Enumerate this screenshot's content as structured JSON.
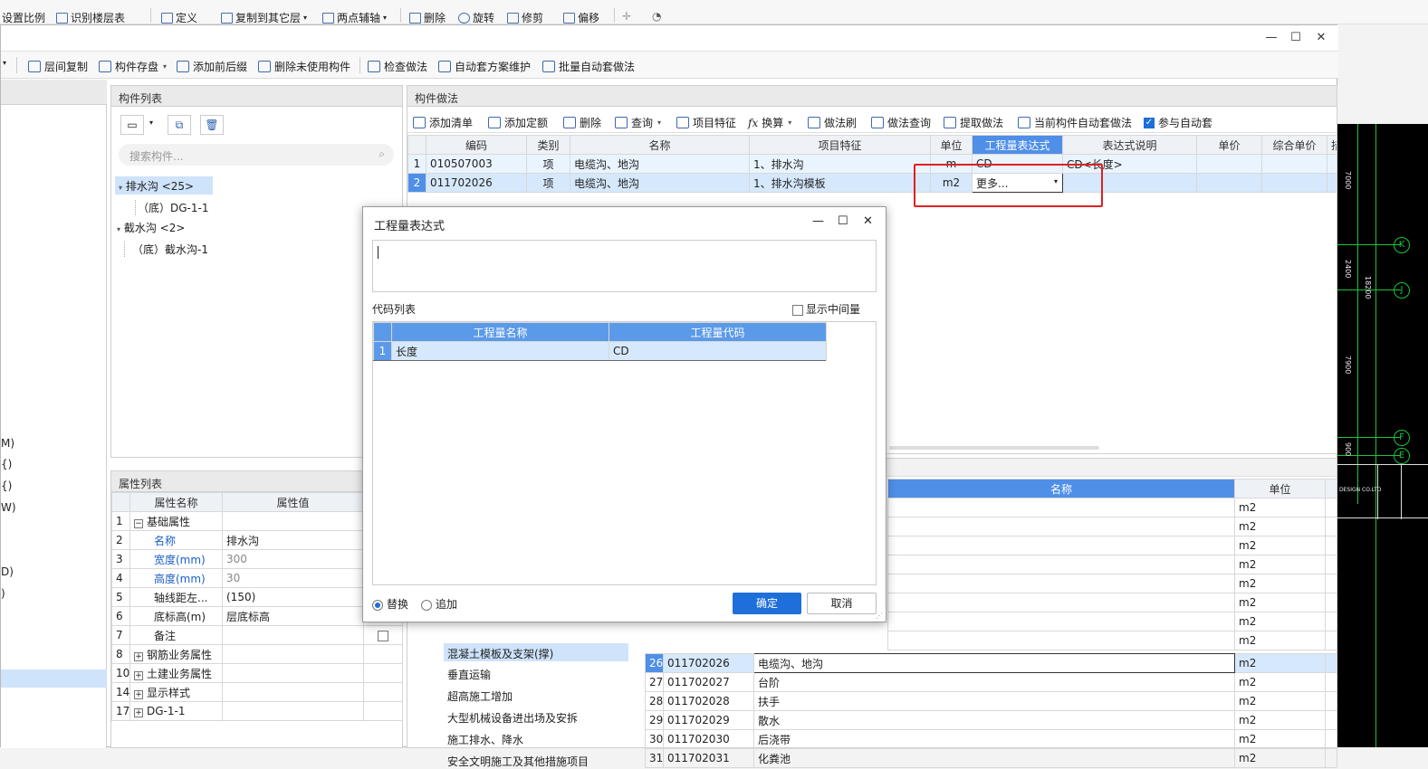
{
  "ribbon": {
    "items": [
      "设置比例",
      "识别楼层表",
      "定义",
      "复制到其它层",
      "两点辅轴",
      "删除",
      "旋转",
      "修剪",
      "偏移"
    ]
  },
  "toolbar": {
    "items": [
      "层间复制",
      "构件存盘",
      "添加前后缀",
      "删除未使用构件",
      "检查做法",
      "自动套方案维护",
      "批量自动套做法"
    ]
  },
  "component_list": {
    "title": "构件列表",
    "search_placeholder": "搜索构件...",
    "tree": [
      {
        "label": "排水沟 <25>",
        "selected": true
      },
      {
        "label": "（底）DG-1-1"
      },
      {
        "label": "截水沟 <2>"
      },
      {
        "label": "（底）截水沟-1"
      }
    ]
  },
  "left_edge_labels": [
    "M)",
    "{)",
    "{)",
    "W)",
    "D)",
    ")"
  ],
  "property_list": {
    "title": "属性列表",
    "col_name": "属性名称",
    "col_value": "属性值",
    "rows": [
      {
        "num": "1",
        "name": "基础属性",
        "value": "",
        "expand": "−"
      },
      {
        "num": "2",
        "name": "名称",
        "value": "排水沟"
      },
      {
        "num": "3",
        "name": "宽度(mm)",
        "value": "300"
      },
      {
        "num": "4",
        "name": "高度(mm)",
        "value": "30"
      },
      {
        "num": "5",
        "name": "轴线距左...",
        "value": "(150)"
      },
      {
        "num": "6",
        "name": "底标高(m)",
        "value": "层底标高"
      },
      {
        "num": "7",
        "name": "备注",
        "value": ""
      },
      {
        "num": "8",
        "name": "钢筋业务属性",
        "value": "",
        "expand": "+"
      },
      {
        "num": "10",
        "name": "土建业务属性",
        "value": "",
        "expand": "+"
      },
      {
        "num": "14",
        "name": "显示样式",
        "value": "",
        "expand": "+"
      },
      {
        "num": "17",
        "name": "DG-1-1",
        "value": "",
        "expand": "+"
      }
    ]
  },
  "method": {
    "title": "构件做法",
    "toolbar": [
      "添加清单",
      "添加定额",
      "删除",
      "查询",
      "项目特征",
      "换算",
      "做法刷",
      "做法查询",
      "提取做法",
      "当前构件自动套做法",
      "参与自动套"
    ],
    "columns": [
      "编码",
      "类别",
      "名称",
      "项目特征",
      "单位",
      "工程量表达式",
      "表达式说明",
      "单价",
      "综合单价",
      "措"
    ],
    "rows": [
      {
        "num": "1",
        "code": "010507003",
        "type": "项",
        "name": "电缆沟、地沟",
        "feature": "1、排水沟",
        "unit": "m",
        "expr": "CD",
        "desc": "CD<长度>"
      },
      {
        "num": "2",
        "code": "011702026",
        "type": "项",
        "name": "电缆沟、地沟",
        "feature": "1、排水沟模板",
        "unit": "m2",
        "expr": "更多...",
        "desc": ""
      }
    ]
  },
  "lower": {
    "col_name": "名称",
    "col_unit": "单位",
    "upper_units": [
      "m2",
      "m2",
      "m2",
      "m2",
      "m2",
      "m2",
      "m2",
      "m2"
    ],
    "tree_items": [
      "混凝土模板及支架(撑)",
      "垂直运输",
      "超高施工增加",
      "大型机械设备进出场及安拆",
      "施工排水、降水",
      "安全文明施工及其他措施项目"
    ],
    "rows": [
      {
        "num": "26",
        "code": "011702026",
        "name": "电缆沟、地沟",
        "unit": "m2"
      },
      {
        "num": "27",
        "code": "011702027",
        "name": "台阶",
        "unit": "m2"
      },
      {
        "num": "28",
        "code": "011702028",
        "name": "扶手",
        "unit": "m2"
      },
      {
        "num": "29",
        "code": "011702029",
        "name": "散水",
        "unit": "m2"
      },
      {
        "num": "30",
        "code": "011702030",
        "name": "后浇带",
        "unit": "m2"
      },
      {
        "num": "31",
        "code": "011702031",
        "name": "化粪池",
        "unit": "m2"
      }
    ]
  },
  "dialog": {
    "title": "工程量表达式",
    "code_list_label": "代码列表",
    "show_intermediate": "显示中间量",
    "col_name": "工程量名称",
    "col_code": "工程量代码",
    "rows": [
      {
        "num": "1",
        "name": "长度",
        "code": "CD"
      }
    ],
    "replace_label": "替换",
    "append_label": "追加",
    "ok_label": "确定",
    "cancel_label": "取消"
  },
  "cad": {
    "axis_labels": [
      "K",
      "J",
      "F",
      "E"
    ],
    "dims": [
      "7000",
      "2400",
      "18200",
      "7900",
      "900"
    ],
    "design_text": "DESIGN CO.LTD"
  },
  "colors": {
    "accent": "#1e6fd9",
    "highlight_red": "#e02020",
    "selection": "#cfe3fb",
    "cad_line": "#18c53a"
  }
}
